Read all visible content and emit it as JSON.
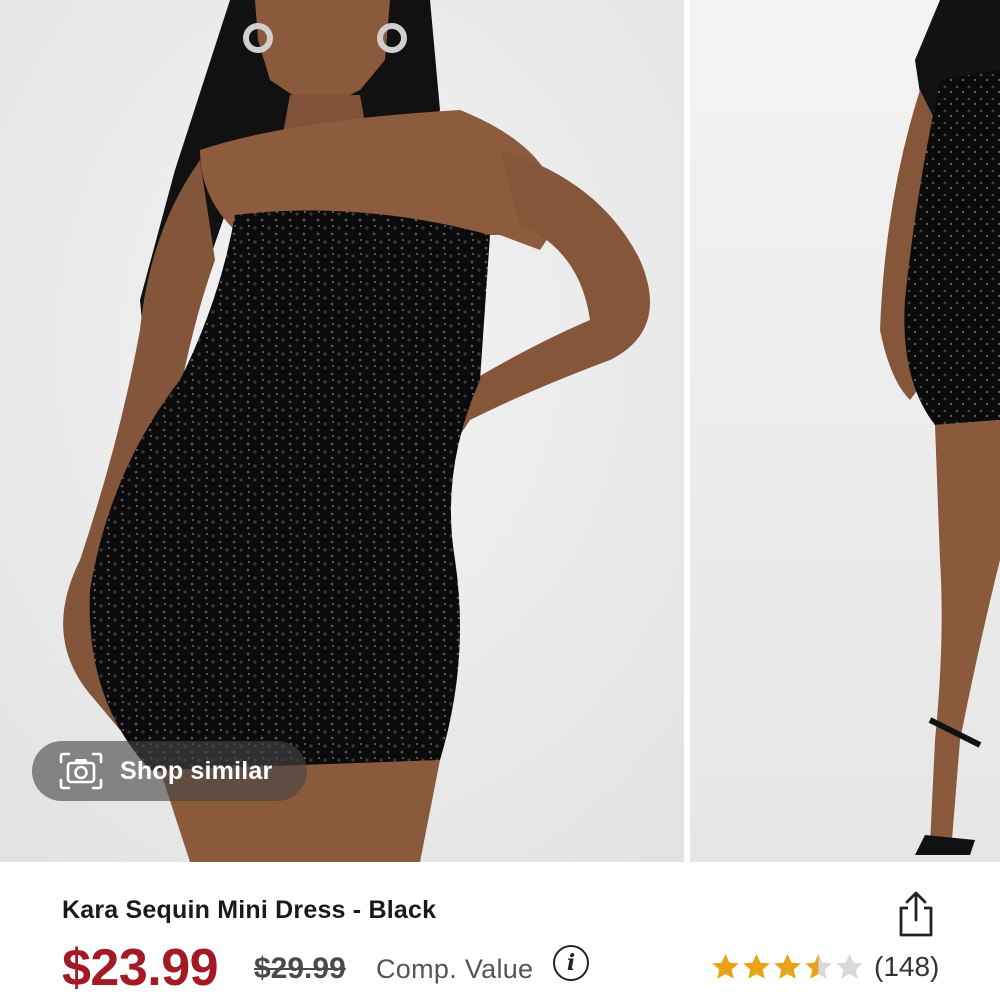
{
  "gallery": {
    "images": [
      {
        "icon": "model-photo-front"
      },
      {
        "icon": "model-photo-side"
      }
    ],
    "shop_similar": {
      "label": "Shop similar",
      "icon": "camera-icon"
    }
  },
  "product": {
    "title": "Kara Sequin Mini Dress - Black",
    "price": "$23.99",
    "original_price": "$29.99",
    "comp_value_label": "Comp. Value",
    "info_icon_glyph": "i",
    "rating": 3.5,
    "rating_max": 5,
    "review_count": "(148)",
    "colors": {
      "price": "#a31a25",
      "star_filled": "#e8a317",
      "star_empty": "#d9d9d9"
    }
  }
}
